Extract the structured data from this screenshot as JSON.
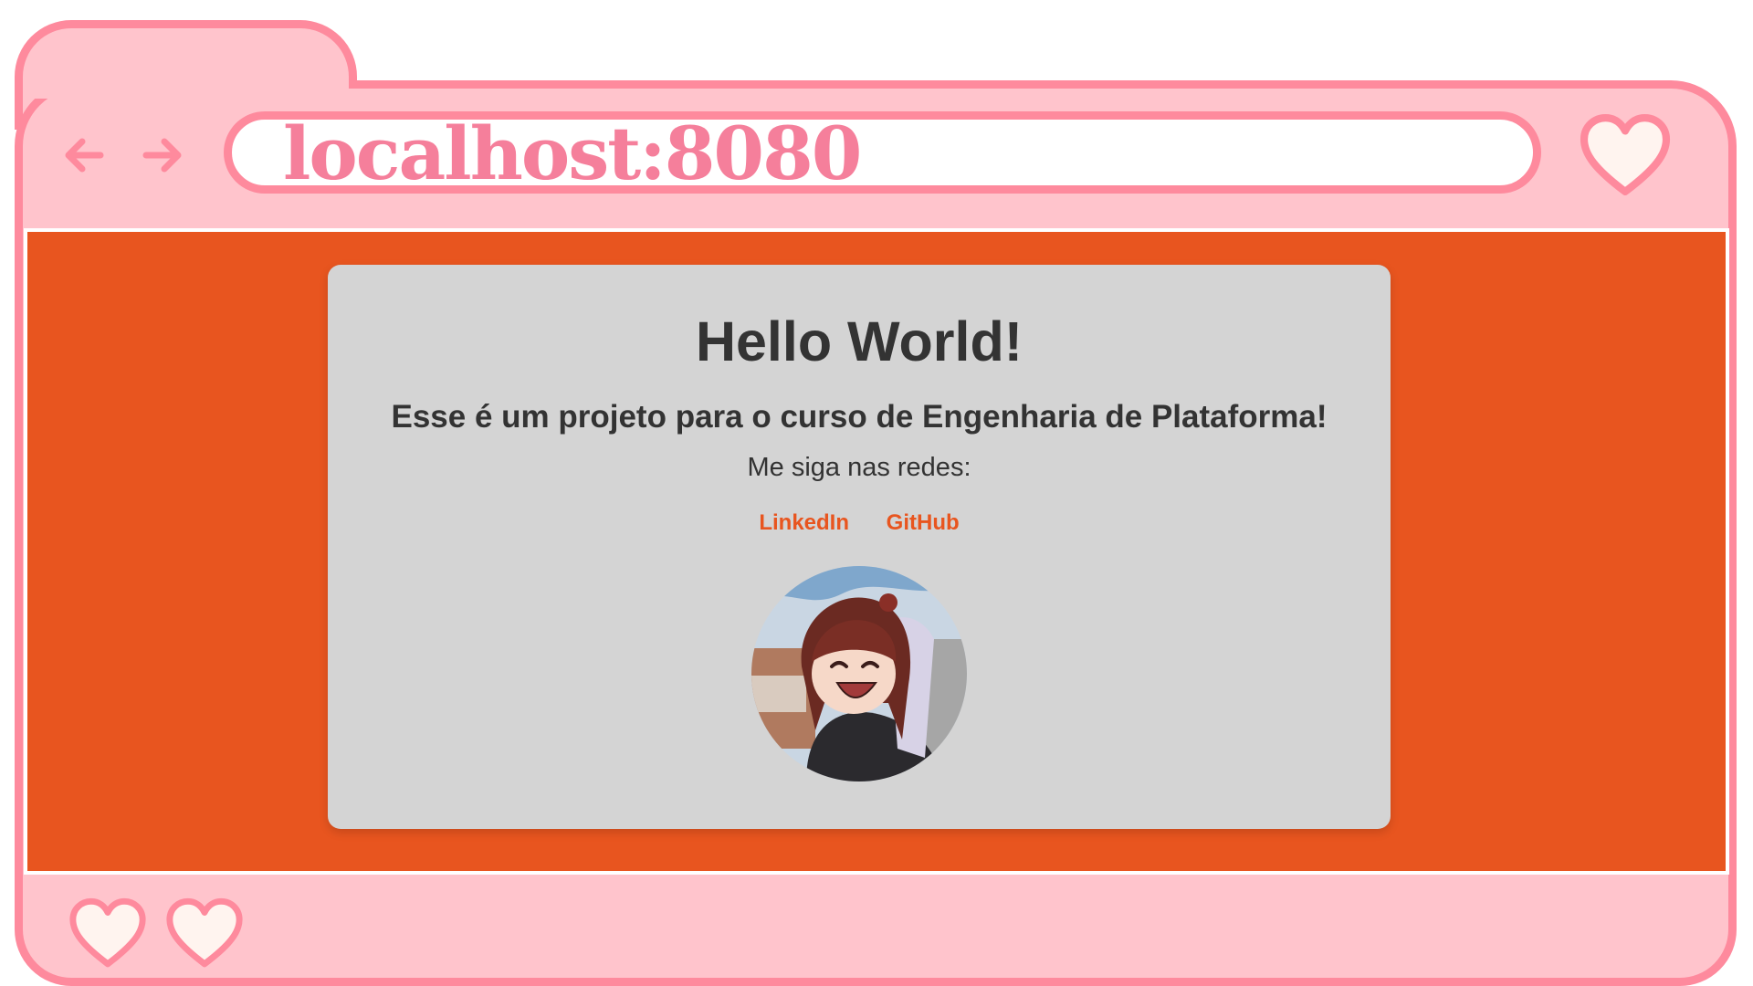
{
  "browser": {
    "url": "localhost:8080",
    "accent_color": "#fe8a9d",
    "frame_color": "#ffc4cc",
    "url_color": "#f57f9b",
    "icons": [
      "back-arrow-icon",
      "forward-arrow-icon",
      "heart-icon"
    ]
  },
  "page": {
    "background": "#e8551f",
    "card_background": "#d4d4d4",
    "title": "Hello World!",
    "subtitle": "Esse é um projeto para o curso de Engenharia de Plataforma!",
    "social_text": "Me siga nas redes:",
    "links": [
      {
        "label": "LinkedIn"
      },
      {
        "label": "GitHub"
      }
    ],
    "link_color": "#e8551f"
  }
}
